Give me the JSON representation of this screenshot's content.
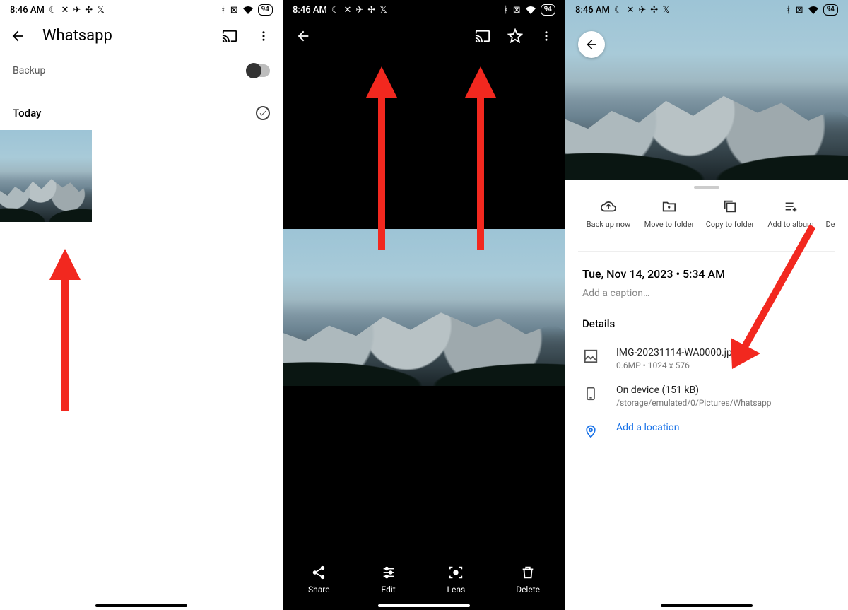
{
  "status": {
    "time": "8:46 AM",
    "battery": "94"
  },
  "panel1": {
    "title": "Whatsapp",
    "backup_label": "Backup",
    "today_label": "Today"
  },
  "panel2": {
    "actions": {
      "share": "Share",
      "edit": "Edit",
      "lens": "Lens",
      "delete": "Delete"
    }
  },
  "panel3": {
    "sheet_actions": {
      "backup": "Back up now",
      "move": "Move to folder",
      "copy": "Copy to folder",
      "add_album": "Add to album",
      "delete_device": "Delete from device"
    },
    "datetime": "Tue, Nov 14, 2023  •  5:34 AM",
    "caption_placeholder": "Add a caption…",
    "details_heading": "Details",
    "file": {
      "name": "IMG-20231114-WA0000.jpg",
      "meta": "0.6MP  •  1024 x 576"
    },
    "storage": {
      "line1": "On device (151 kB)",
      "line2": "/storage/emulated/0/Pictures/Whatsapp"
    },
    "location_label": "Add a location"
  },
  "colors": {
    "arrow": "#f2281f",
    "link": "#1a73e8"
  }
}
